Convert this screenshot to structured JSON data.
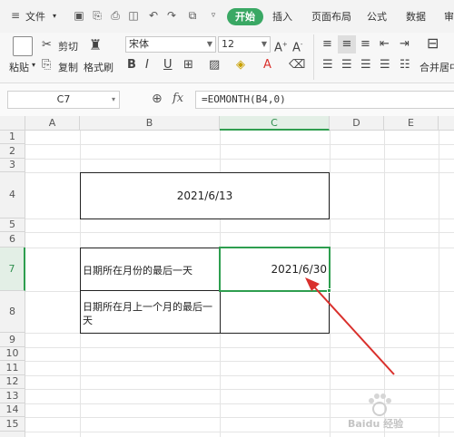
{
  "menu": {
    "file": "文件",
    "tabs": [
      "开始",
      "插入",
      "页面布局",
      "公式",
      "数据",
      "审"
    ]
  },
  "ribbon": {
    "paste": "粘贴",
    "cut": "剪切",
    "copy": "复制",
    "format_painter": "格式刷",
    "font_name": "宋体",
    "font_size": "12",
    "merge_center": "合并居中"
  },
  "formula_bar": {
    "name_box": "C7",
    "fx": "fx",
    "formula": "=EOMONTH(B4,0)"
  },
  "sheet": {
    "columns": [
      "A",
      "B",
      "C",
      "D",
      "E"
    ],
    "rows": [
      "1",
      "2",
      "3",
      "4",
      "5",
      "6",
      "7",
      "8",
      "9",
      "10",
      "11",
      "12",
      "13",
      "14",
      "15"
    ],
    "b4_date": "2021/6/13",
    "b7_label": "日期所在月份的最后一天",
    "c7_value": "2021/6/30",
    "b8_label": "日期所在月上一个月的最后一天"
  },
  "colors": {
    "accent": "#3aa864",
    "selection": "#2e9e4f",
    "arrow": "#d9302c"
  },
  "watermark": "Baidu 经验"
}
